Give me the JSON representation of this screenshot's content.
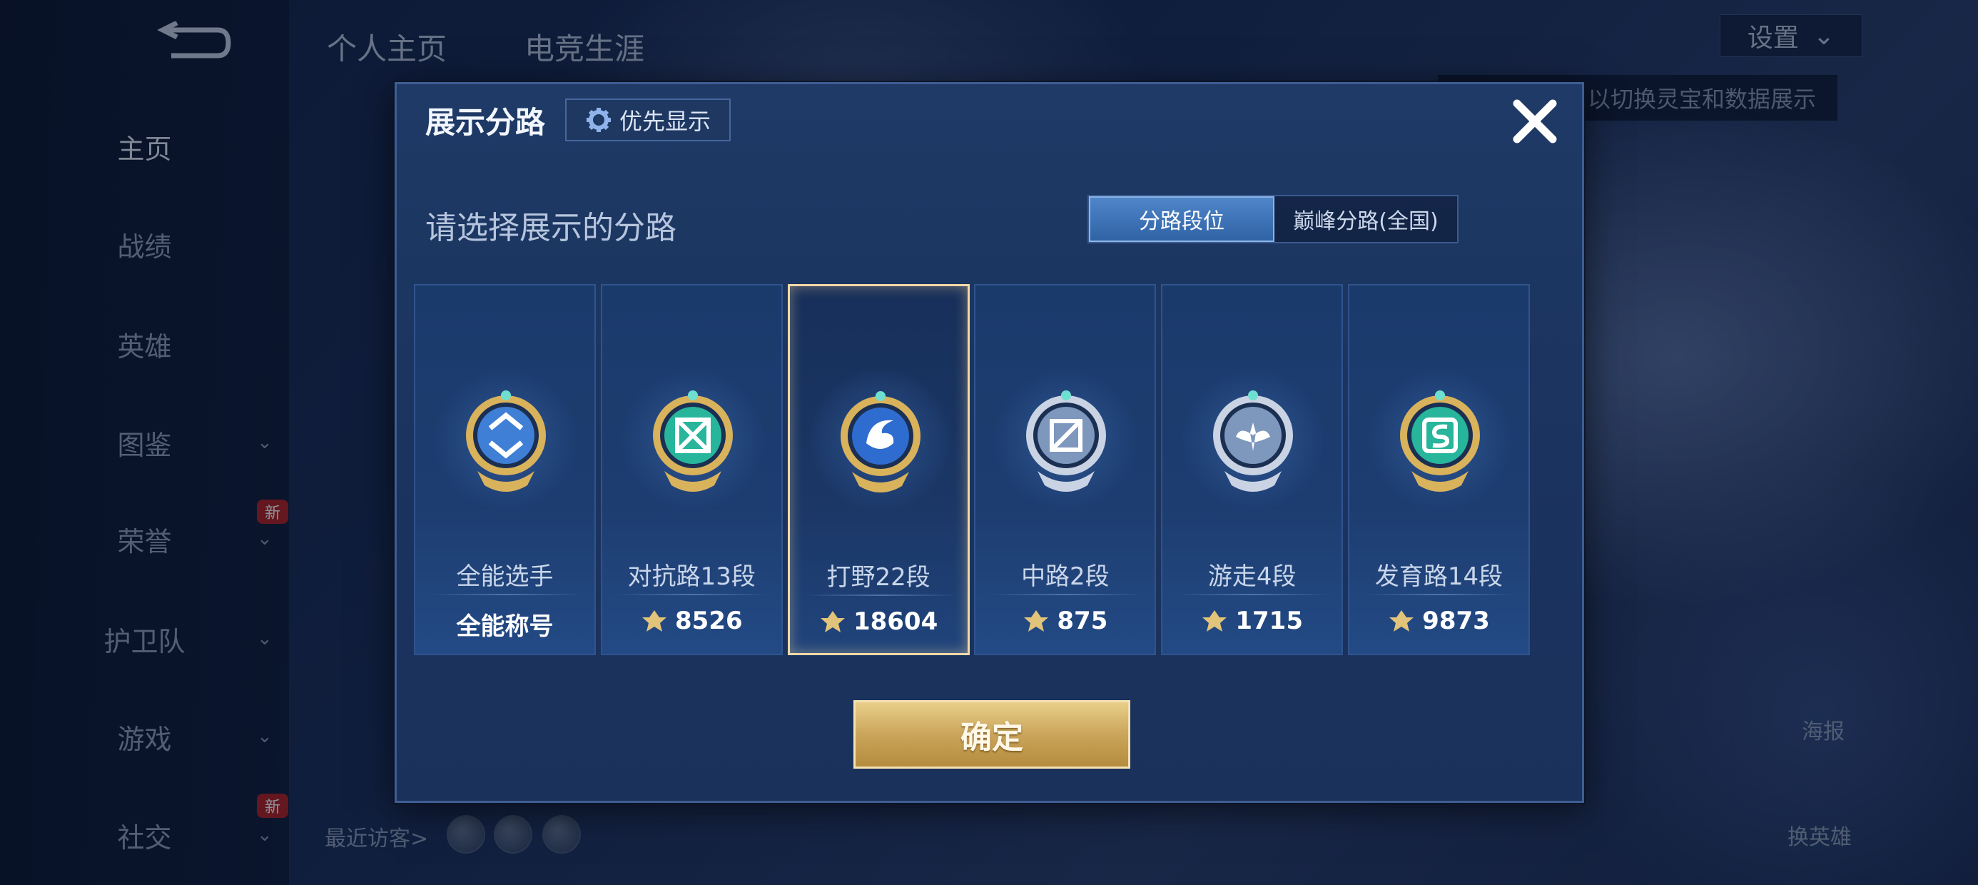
{
  "nav": {
    "items": [
      {
        "label": "主页",
        "active": true
      },
      {
        "label": "战绩"
      },
      {
        "label": "英雄"
      },
      {
        "label": "图鉴",
        "chevron": true
      },
      {
        "label": "荣誉",
        "chevron": true,
        "badge": "新"
      },
      {
        "label": "护卫队",
        "chevron": true
      },
      {
        "label": "游戏",
        "chevron": true
      },
      {
        "label": "社交",
        "chevron": true,
        "badge": "新"
      }
    ]
  },
  "top_tabs": [
    "个人主页",
    "电竞生涯"
  ],
  "settings_label": "设置",
  "hint_text": "以切换灵宝和数据展示",
  "right_side": {
    "poster": "海报",
    "switch_hero": "换英雄"
  },
  "recent_visitors_label": "最近访客>",
  "dialog": {
    "title": "展示分路",
    "priority_label": "优先显示",
    "prompt": "请选择展示的分路",
    "segment": [
      "分路段位",
      "巅峰分路(全国)"
    ],
    "confirm_label": "确定",
    "cards": [
      {
        "name": "全能选手",
        "score": "全能称号",
        "has_icon": false,
        "emblem": "allround",
        "selected": false
      },
      {
        "name": "对抗路13段",
        "score": "8526",
        "has_icon": true,
        "emblem": "clash",
        "selected": false
      },
      {
        "name": "打野22段",
        "score": "18604",
        "has_icon": true,
        "emblem": "jungle",
        "selected": true
      },
      {
        "name": "中路2段",
        "score": "875",
        "has_icon": true,
        "emblem": "mid",
        "selected": false
      },
      {
        "name": "游走4段",
        "score": "1715",
        "has_icon": true,
        "emblem": "roam",
        "selected": false
      },
      {
        "name": "发育路14段",
        "score": "9873",
        "has_icon": true,
        "emblem": "farm",
        "selected": false
      }
    ]
  }
}
